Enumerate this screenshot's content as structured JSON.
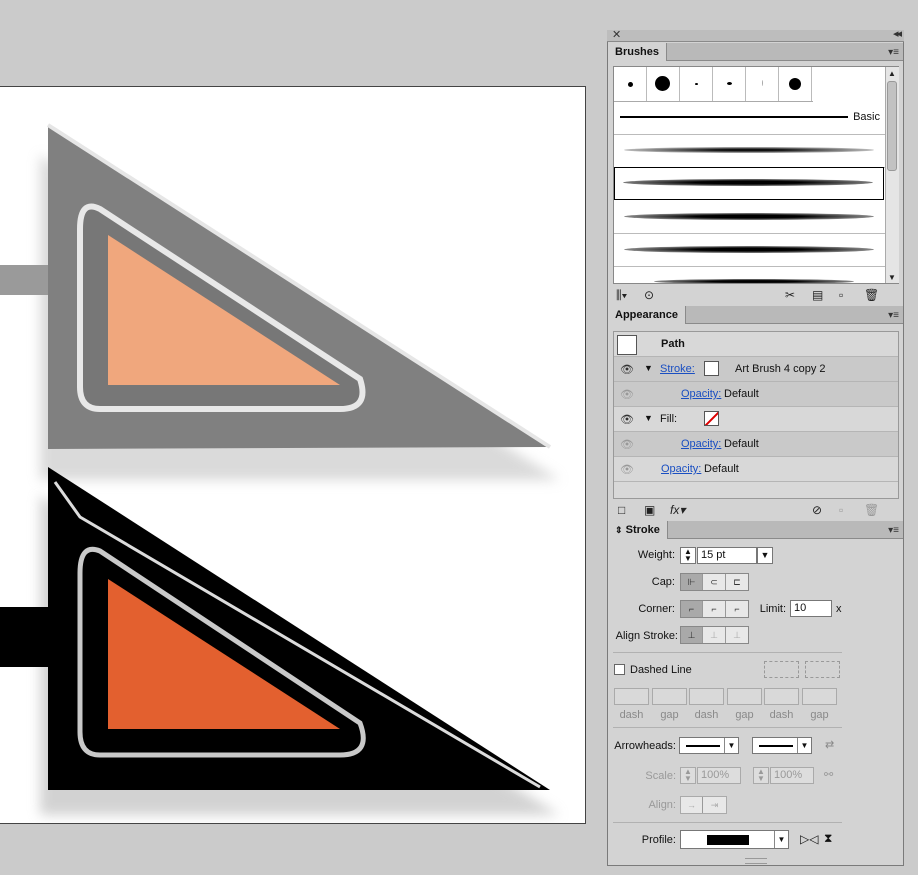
{
  "brushes": {
    "tab": "Brushes",
    "basic_label": "Basic"
  },
  "appearance": {
    "tab": "Appearance",
    "path_label": "Path",
    "stroke_label": "Stroke:",
    "stroke_value": "Art Brush 4 copy 2",
    "opacity_label": "Opacity:",
    "opacity_value": "Default",
    "fill_label": "Fill:"
  },
  "stroke": {
    "tab": "Stroke",
    "weight_label": "Weight:",
    "weight_value": "15 pt",
    "cap_label": "Cap:",
    "corner_label": "Corner:",
    "limit_label": "Limit:",
    "limit_value": "10",
    "limit_unit": "x",
    "align_label": "Align Stroke:",
    "dashed_label": "Dashed Line",
    "dash_labels": [
      "dash",
      "gap",
      "dash",
      "gap",
      "dash",
      "gap"
    ],
    "arrowheads_label": "Arrowheads:",
    "scale_label": "Scale:",
    "scale_value_1": "100%",
    "scale_value_2": "100%",
    "align_arrow_label": "Align:",
    "profile_label": "Profile:"
  },
  "colors": {
    "canvas": "#ffffff",
    "panel_bg": "#d3d3d3",
    "orange_light": "#f0a77d",
    "orange_dark": "#e3602f",
    "link": "#1a4fc2"
  }
}
